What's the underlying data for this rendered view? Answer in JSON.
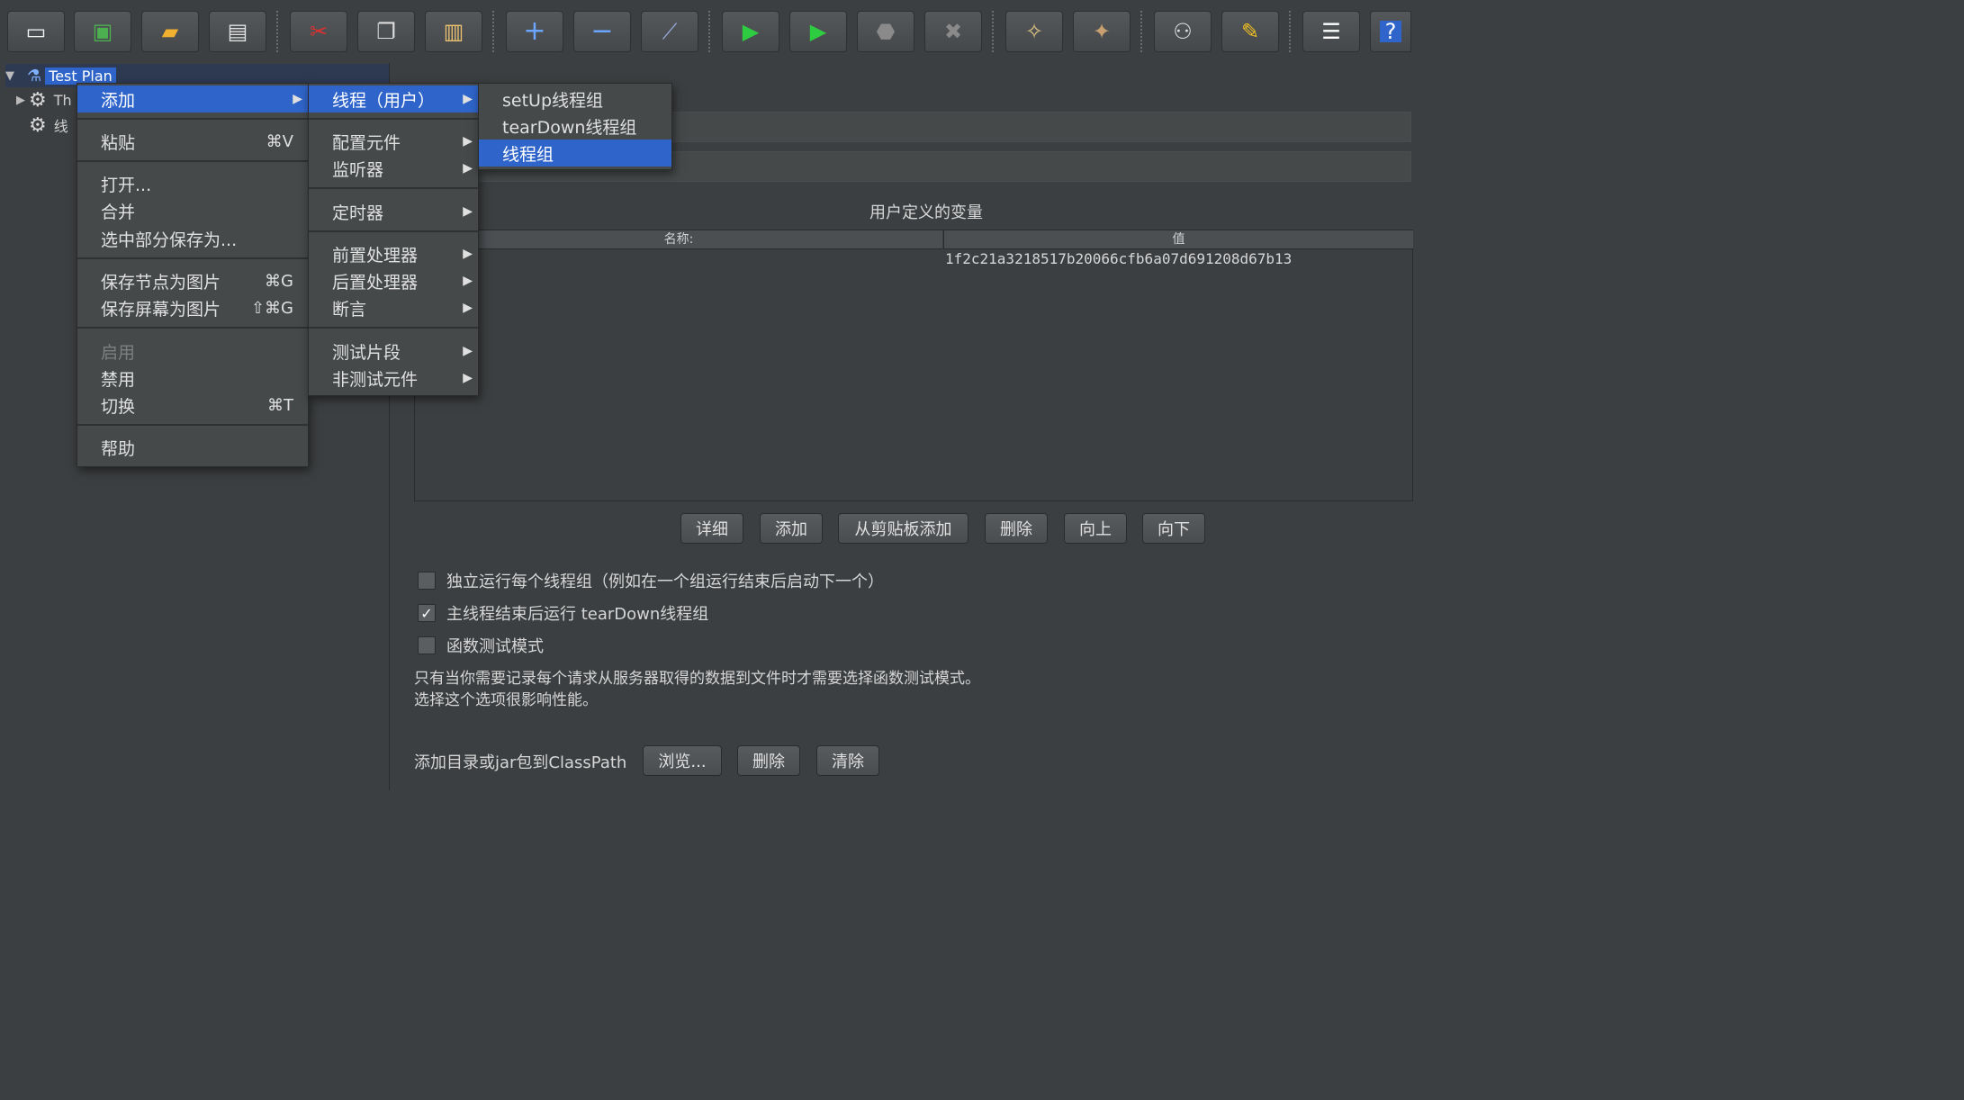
{
  "toolbar": {
    "buttons": [
      {
        "name": "new-icon",
        "glyph": "▭",
        "color": "#f5f5f5"
      },
      {
        "name": "templates-icon",
        "glyph": "▣",
        "color": "#4caf50"
      },
      {
        "name": "open-icon",
        "glyph": "▰",
        "color": "#f0b030"
      },
      {
        "name": "save-icon",
        "glyph": "▤",
        "color": "#e0e0e0"
      },
      {
        "name": "cut-icon",
        "glyph": "✂",
        "color": "#e03030"
      },
      {
        "name": "copy-icon",
        "glyph": "❐",
        "color": "#dddddd"
      },
      {
        "name": "paste-icon",
        "glyph": "▥",
        "color": "#e8c070"
      },
      {
        "name": "expand-icon",
        "glyph": "+",
        "color": "#6aa6ff"
      },
      {
        "name": "collapse-icon",
        "glyph": "−",
        "color": "#6aa6ff"
      },
      {
        "name": "toggle-icon",
        "glyph": "⟋",
        "color": "#9ad"
      },
      {
        "name": "start-icon",
        "glyph": "▶",
        "color": "#2ecc40"
      },
      {
        "name": "start-no-pauses-icon",
        "glyph": "▶",
        "color": "#2ecc40"
      },
      {
        "name": "stop-icon",
        "glyph": "⬣",
        "color": "#8a8a8a"
      },
      {
        "name": "shutdown-icon",
        "glyph": "✖",
        "color": "#8a8a8a"
      },
      {
        "name": "clear-icon",
        "glyph": "✧",
        "color": "#d8c080"
      },
      {
        "name": "clear-all-icon",
        "glyph": "✦",
        "color": "#c8a070"
      },
      {
        "name": "search-icon",
        "glyph": "⚇",
        "color": "#dddddd"
      },
      {
        "name": "reset-search-icon",
        "glyph": "✎",
        "color": "#f0c020"
      },
      {
        "name": "function-helper-icon",
        "glyph": "☰",
        "color": "#ffffff"
      },
      {
        "name": "help-icon",
        "glyph": "?",
        "color": "#ffffff"
      }
    ]
  },
  "tree": {
    "root_label": "Test Plan",
    "child1_label": "Th",
    "child2_label": "线"
  },
  "table": {
    "title": "用户定义的变量",
    "col_name": "名称:",
    "col_value": "值",
    "row_value": "1f2c21a3218517b20066cfb6a07d691208d67b13"
  },
  "buttons": {
    "detail": "详细",
    "add": "添加",
    "add_clipboard": "从剪贴板添加",
    "delete": "删除",
    "up": "向上",
    "down": "向下"
  },
  "options": {
    "serialize": "独立运行每个线程组（例如在一个组运行结束后启动下一个）",
    "serialize_checked": false,
    "teardown": "主线程结束后运行 tearDown线程组",
    "teardown_checked": true,
    "functional": "函数测试模式",
    "functional_checked": false,
    "note_line1": "只有当你需要记录每个请求从服务器取得的数据到文件时才需要选择函数测试模式。",
    "note_line2": "选择这个选项很影响性能。"
  },
  "classpath": {
    "label": "添加目录或jar包到ClassPath",
    "browse": "浏览...",
    "delete": "删除",
    "clear": "清除"
  },
  "menu1": {
    "add": "添加",
    "paste": "粘贴",
    "paste_shortcut": "⌘V",
    "open": "打开...",
    "merge": "合并",
    "save_selection": "选中部分保存为...",
    "save_node_image": "保存节点为图片",
    "save_node_image_shortcut": "⌘G",
    "save_screen_image": "保存屏幕为图片",
    "save_screen_image_shortcut": "⇧⌘G",
    "enable": "启用",
    "disable": "禁用",
    "toggle": "切换",
    "toggle_shortcut": "⌘T",
    "help": "帮助"
  },
  "menu2": {
    "threads": "线程（用户）",
    "config": "配置元件",
    "listener": "监听器",
    "timer": "定时器",
    "pre": "前置处理器",
    "post": "后置处理器",
    "assertion": "断言",
    "fragment": "测试片段",
    "non_test": "非测试元件"
  },
  "menu3": {
    "setup": "setUp线程组",
    "teardown": "tearDown线程组",
    "thread_group": "线程组"
  }
}
